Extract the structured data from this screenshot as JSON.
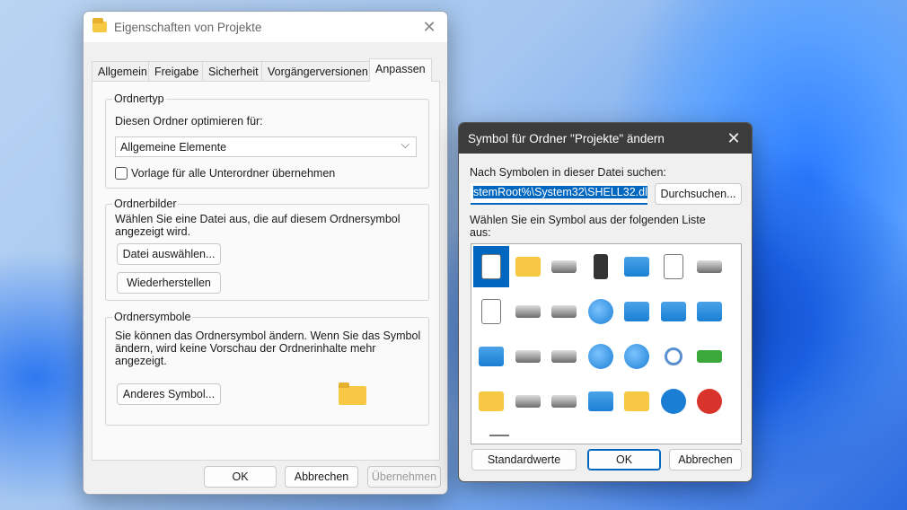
{
  "properties_dialog": {
    "title": "Eigenschaften von Projekte",
    "tabs": [
      "Allgemein",
      "Freigabe",
      "Sicherheit",
      "Vorgängerversionen",
      "Anpassen"
    ],
    "active_tab": "Anpassen",
    "ordnertyp": {
      "legend": "Ordnertyp",
      "label": "Diesen Ordner optimieren für:",
      "select_value": "Allgemeine Elemente",
      "checkbox_label": "Vorlage für alle Unterordner übernehmen",
      "checked": false
    },
    "ordnerbilder": {
      "legend": "Ordnerbilder",
      "description": "Wählen Sie eine Datei aus, die auf diesem Ordnersymbol angezeigt wird.",
      "choose_button": "Datei auswählen...",
      "restore_button": "Wiederherstellen"
    },
    "ordnersymbole": {
      "legend": "Ordnersymbole",
      "description": "Sie können das Ordnersymbol ändern. Wenn Sie das Symbol ändern, wird keine Vorschau der Ordnerinhalte mehr angezeigt.",
      "change_button": "Anderes Symbol..."
    },
    "buttons": {
      "ok": "OK",
      "cancel": "Abbrechen",
      "apply": "Übernehmen"
    }
  },
  "icon_dialog": {
    "title": "Symbol für Ordner \"Projekte\" ändern",
    "file_label": "Nach Symbolen in dieser Datei suchen:",
    "file_value": "stemRoot%\\System32\\SHELL32.dll",
    "browse_button": "Durchsuchen...",
    "list_label": "Wählen Sie ein Symbol aus der folgenden Liste aus:",
    "icons": [
      [
        "blank-document",
        "folder",
        "drive",
        "memory-chip",
        "printer",
        "clock-document",
        "removable-drive"
      ],
      [
        "text-document",
        "floppy-drive",
        "drive-green",
        "globe",
        "network-computer",
        "control-panel",
        "monitor-moon"
      ],
      [
        "window-app",
        "floppy-drive",
        "drive-disconnected",
        "network-globe",
        "network",
        "magnifier",
        "green-arrow"
      ],
      [
        "folder",
        "drive",
        "cd-drive",
        "monitor",
        "folder-grid",
        "help",
        "power"
      ]
    ],
    "icon_colors": {
      "folder": "#f7c843",
      "blue": "#1a7fd4",
      "gray": "#6d6d6d",
      "red": "#d9342b"
    },
    "buttons": {
      "defaults": "Standardwerte",
      "ok": "OK",
      "cancel": "Abbrechen"
    }
  }
}
